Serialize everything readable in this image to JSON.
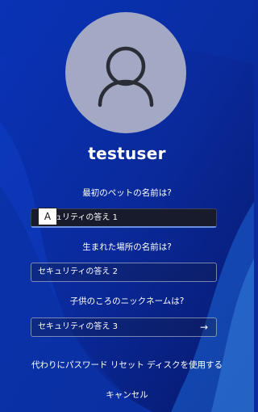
{
  "colors": {
    "background": "#0b2a9e",
    "avatar": "#a3a8c4",
    "focus_underline": "#6d8fdf"
  },
  "avatar": {
    "icon": "user-icon"
  },
  "username": "testuser",
  "questions": [
    {
      "question": "最初のペットの名前は?",
      "placeholder": "セキュリティの答え 1"
    },
    {
      "question": "生まれた場所の名前は?",
      "placeholder": "セキュリティの答え 2"
    },
    {
      "question": "子供のころのニックネームは?",
      "placeholder": "セキュリティの答え 3"
    }
  ],
  "submit_icon": "arrow-right-icon",
  "key_badge": "A",
  "reset_disk_link": "代わりにパスワード リセット ディスクを使用する",
  "cancel_link": "キャンセル"
}
